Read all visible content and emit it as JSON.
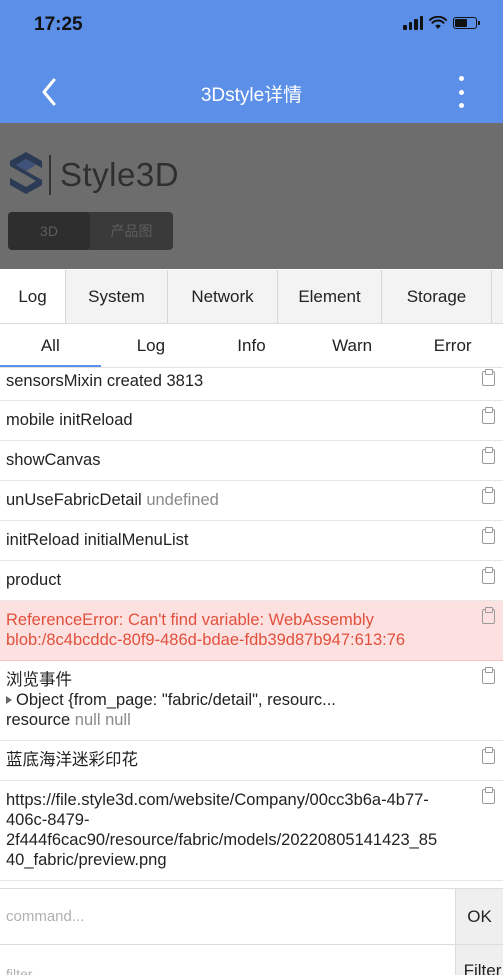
{
  "status_bar": {
    "time": "17:25"
  },
  "nav": {
    "title": "3Dstyle详情"
  },
  "product": {
    "logo_text": "Style3D",
    "view_tabs": [
      "3D",
      "产品图"
    ]
  },
  "console": {
    "tabs": [
      "Log",
      "System",
      "Network",
      "Element",
      "Storage"
    ],
    "subtabs": [
      "All",
      "Log",
      "Info",
      "Warn",
      "Error"
    ]
  },
  "logs": {
    "row1": "sensorsMixin created 3813",
    "row2": "mobile initReload",
    "row3": "showCanvas",
    "row4_main": "unUseFabricDetail",
    "row4_muted": "undefined",
    "row5": "initReload initialMenuList",
    "row6": "product",
    "row7_line1": "ReferenceError: Can't find variable: WebAssembly",
    "row7_line2": "blob:/8c4bcddc-80f9-486d-bdae-fdb39d87b947:613:76",
    "row8_line1": "浏览事件",
    "row8_line2": "Object {from_page: \"fabric/detail\", resourc...",
    "row8_line3_main": "resource",
    "row8_line3_muted": "null null",
    "row9": "蓝底海洋迷彩印花",
    "row10_line1": "https://file.style3d.com/website/Company/00cc3b6a-4b77-",
    "row10_line2": "406c-8479-",
    "row10_line3": "2f444f6cac90/resource/fabric/models/20220805141423_85",
    "row10_line4": "40_fabric/preview.png"
  },
  "command": {
    "placeholder": "command...",
    "ok_label": "OK"
  },
  "filter": {
    "placeholder": "filter...",
    "button_label": "Filter"
  },
  "colors": {
    "header": "#5b8fe8",
    "error_bg": "#fde1e1",
    "error_text": "#e0503c"
  }
}
